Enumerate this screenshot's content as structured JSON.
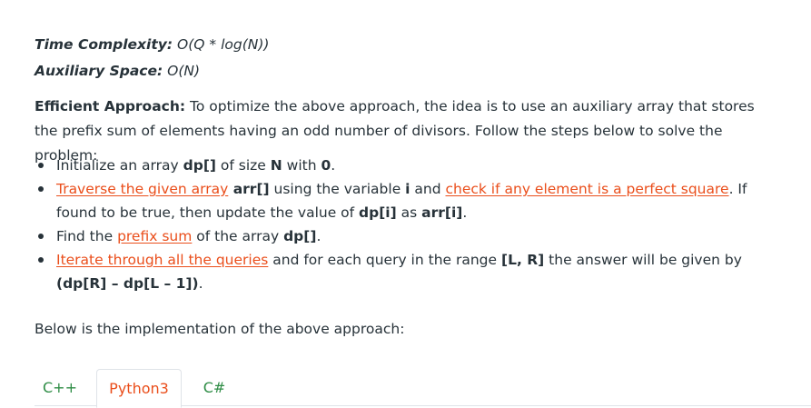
{
  "complexity": {
    "time_label": "Time Complexity:",
    "time_value": "O(Q * log(N))",
    "space_label": "Auxiliary Space:",
    "space_value": "O(N)"
  },
  "approach": {
    "label": "Efficient Approach:",
    "text": " To optimize the above approach, the idea is to use an auxiliary array that stores the prefix sum of elements having an odd number of divisors. Follow the steps below to solve the problem:"
  },
  "steps": [
    {
      "p1": "Initialize an array ",
      "b1": "dp[]",
      "p2": " of size ",
      "b2": "N",
      "p3": " with ",
      "b3": "0",
      "p4": "."
    },
    {
      "link1": "Traverse the given array",
      "b1": " arr[]",
      "p1": " using the variable ",
      "b2": "i",
      "p2": " and ",
      "link2": "check if any element is a perfect square",
      "p3": ". If found to be true, then update the value of ",
      "b3": "dp[i]",
      "p4": " as ",
      "b4": "arr[i]",
      "p5": "."
    },
    {
      "p1": "Find the ",
      "link1": "prefix sum",
      "p2": " of the array ",
      "b1": "dp[]",
      "p3": "."
    },
    {
      "link1": "Iterate through all the queries",
      "p1": " and for each query in the range ",
      "b1": "[L, R]",
      "p2": " the answer will be given by ",
      "b2": "(dp[R] – dp[L – 1])",
      "p3": "."
    }
  ],
  "implementation_note": "Below is the implementation of the above approach:",
  "tabs": [
    {
      "label": "C++",
      "active": false
    },
    {
      "label": "Python3",
      "active": true
    },
    {
      "label": "C#",
      "active": false
    }
  ],
  "colors": {
    "text": "#273239",
    "link": "#ea4e1b",
    "tab_green": "#2f8d46"
  }
}
